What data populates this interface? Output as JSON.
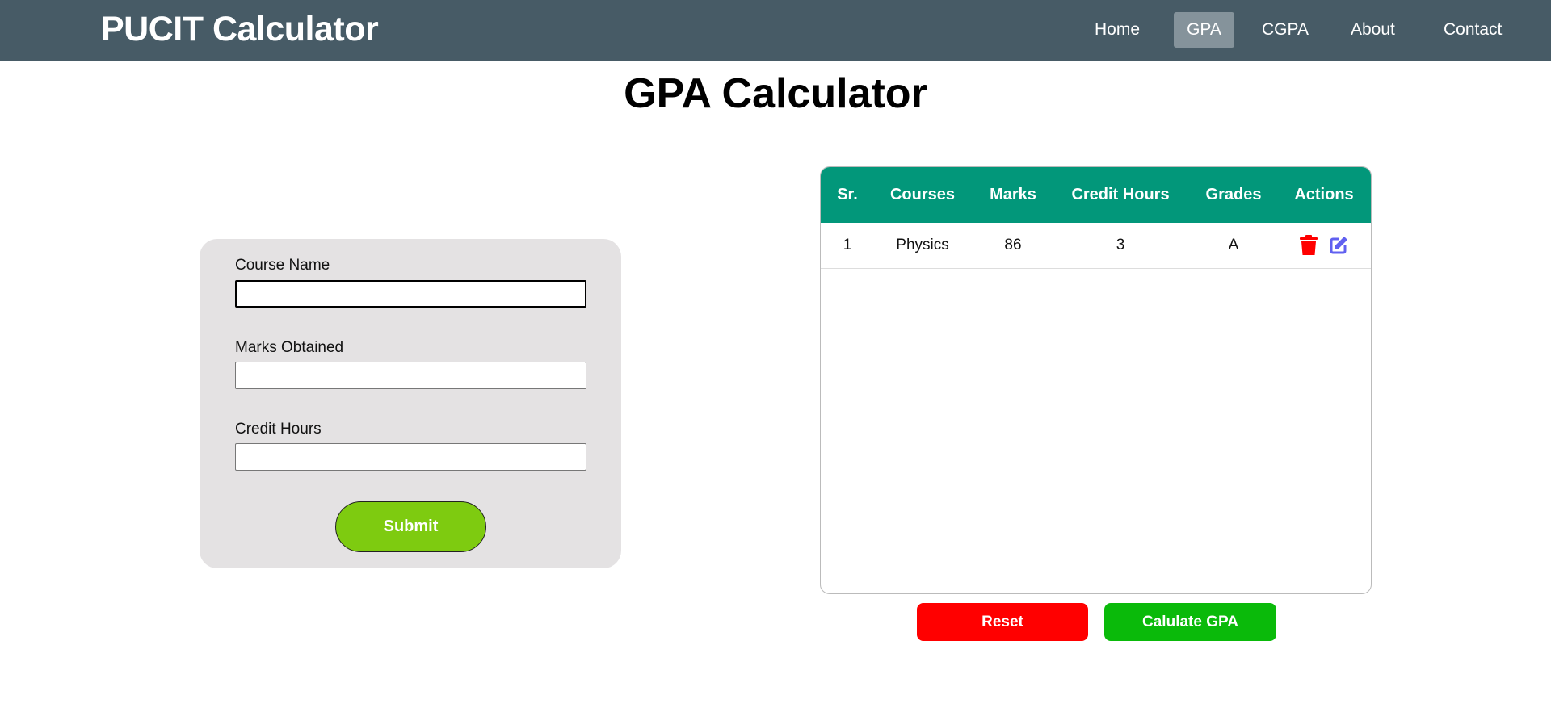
{
  "header": {
    "logo": "PUCIT Calculator",
    "nav": [
      {
        "label": "Home"
      },
      {
        "label": "GPA",
        "active": true
      },
      {
        "label": "CGPA"
      },
      {
        "label": "About"
      },
      {
        "label": "Contact"
      }
    ]
  },
  "page_title": "GPA Calculator",
  "form": {
    "course_label": "Course Name",
    "course_value": "",
    "marks_label": "Marks Obtained",
    "marks_value": "",
    "credit_label": "Credit Hours",
    "credit_value": "",
    "submit_label": "Submit"
  },
  "table": {
    "headers": [
      "Sr.",
      "Courses",
      "Marks",
      "Credit Hours",
      "Grades",
      "Actions"
    ],
    "rows": [
      {
        "sr": "1",
        "course": "Physics",
        "marks": "86",
        "credit": "3",
        "grade": "A"
      }
    ]
  },
  "actions": {
    "reset_label": "Reset",
    "calc_label": "Calulate GPA"
  },
  "colors": {
    "nav": "#475b66",
    "table_header": "#02977a",
    "submit": "#7ecb10",
    "reset": "#ff0000",
    "calc": "#0aba0a",
    "delete_icon": "#ff0000",
    "edit_icon": "#6060f0"
  }
}
